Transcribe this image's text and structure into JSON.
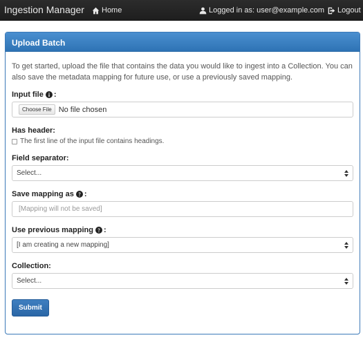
{
  "navbar": {
    "brand": "Ingestion Manager",
    "home_label": "Home",
    "user_label": "Logged in as: user@example.com",
    "logout_label": "Logout"
  },
  "panel": {
    "title": "Upload Batch",
    "intro": "To get started, upload the file that contains the data you would like to ingest into a Collection. You can also save the metadata mapping for future use, or use a previously saved mapping."
  },
  "form": {
    "input_file": {
      "label": "Input file",
      "suffix": ":",
      "button": "Choose File",
      "status": "No file chosen"
    },
    "has_header": {
      "label": "Has header:",
      "checkbox_label": "The first line of the input file contains headings.",
      "checked": false
    },
    "field_separator": {
      "label": "Field separator:",
      "selected": "Select..."
    },
    "save_mapping": {
      "label": "Save mapping as",
      "suffix": ":",
      "placeholder": "[Mapping will not be saved]"
    },
    "previous_mapping": {
      "label": "Use previous mapping",
      "suffix": ":",
      "selected": "[I am creating a new mapping]"
    },
    "collection": {
      "label": "Collection:",
      "selected": "Select..."
    },
    "submit_label": "Submit"
  },
  "icons": {
    "home": "home-icon",
    "user": "user-icon",
    "logout": "logout-icon",
    "info": "info-circle-icon",
    "select_arrows": "select-arrows-icon"
  },
  "colors": {
    "navbar": "#222222",
    "panel_heading": "#3a80c4",
    "submit": "#3474b5"
  }
}
